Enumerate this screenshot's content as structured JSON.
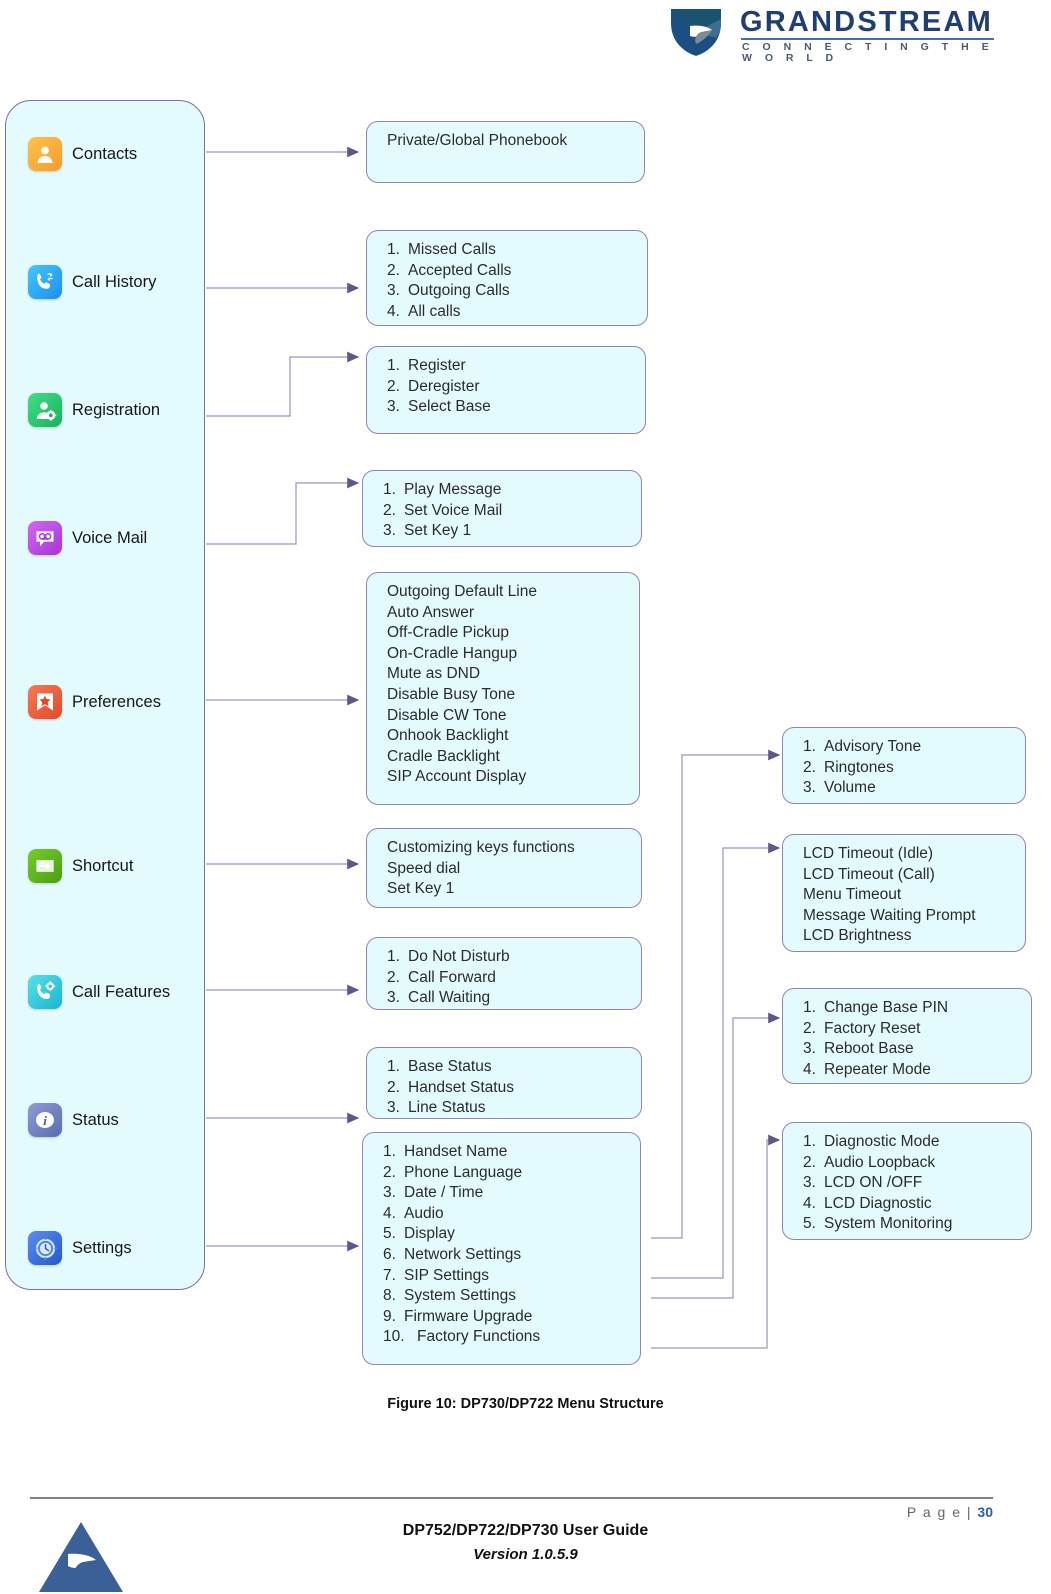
{
  "header": {
    "brand": "GRANDSTREAM",
    "tagline": "C O N N E C T I N G   T H E   W O R L D",
    "logo_icon": "grandstream-shield-logo"
  },
  "menu": {
    "items": [
      {
        "label": "Contacts",
        "icon": "contacts-icon"
      },
      {
        "label": "Call History",
        "icon": "call-history-icon"
      },
      {
        "label": "Registration",
        "icon": "registration-icon"
      },
      {
        "label": "Voice Mail",
        "icon": "voice-mail-icon"
      },
      {
        "label": "Preferences",
        "icon": "preferences-icon"
      },
      {
        "label": "Shortcut",
        "icon": "shortcut-icon"
      },
      {
        "label": "Call Features",
        "icon": "call-features-icon"
      },
      {
        "label": "Status",
        "icon": "status-info-icon"
      },
      {
        "label": "Settings",
        "icon": "settings-gear-icon"
      }
    ]
  },
  "boxes": {
    "contacts": {
      "numbered": false,
      "lines": [
        "Private/Global Phonebook"
      ]
    },
    "call_history": {
      "numbered": true,
      "lines": [
        "Missed Calls",
        "Accepted Calls",
        "Outgoing Calls",
        "All calls"
      ]
    },
    "registration": {
      "numbered": true,
      "lines": [
        "Register",
        "Deregister",
        "Select Base"
      ]
    },
    "voice_mail": {
      "numbered": true,
      "lines": [
        "Play Message",
        "Set Voice Mail",
        "Set Key 1"
      ]
    },
    "preferences": {
      "numbered": false,
      "lines": [
        "Outgoing Default Line",
        "Auto Answer",
        "Off-Cradle Pickup",
        "On-Cradle Hangup",
        "Mute as DND",
        "Disable Busy Tone",
        "Disable CW Tone",
        "Onhook Backlight",
        "Cradle Backlight",
        "SIP Account Display"
      ]
    },
    "shortcut": {
      "numbered": false,
      "lines": [
        "Customizing keys functions",
        "Speed dial",
        "Set Key 1"
      ]
    },
    "call_features": {
      "numbered": true,
      "lines": [
        "Do Not Disturb",
        "Call Forward",
        "Call Waiting"
      ]
    },
    "status": {
      "numbered": true,
      "lines": [
        "Base Status",
        "Handset Status",
        "Line Status"
      ]
    },
    "settings": {
      "numbered": true,
      "lines": [
        "Handset Name",
        "Phone Language",
        "Date / Time",
        "Audio",
        "Display",
        "Network Settings",
        "SIP Settings",
        "System Settings",
        "Firmware Upgrade",
        "Factory Functions"
      ]
    },
    "audio": {
      "numbered": true,
      "lines": [
        "Advisory Tone",
        "Ringtones",
        "Volume"
      ]
    },
    "display": {
      "numbered": false,
      "lines": [
        "LCD Timeout (Idle)",
        "LCD Timeout (Call)",
        "Menu Timeout",
        "Message Waiting Prompt",
        "LCD Brightness"
      ]
    },
    "system": {
      "numbered": true,
      "lines": [
        "Change Base PIN",
        "Factory Reset",
        "Reboot Base",
        "Repeater Mode"
      ]
    },
    "factory": {
      "numbered": true,
      "lines": [
        "Diagnostic Mode",
        "Audio Loopback",
        "LCD ON /OFF",
        "LCD Diagnostic",
        "System Monitoring"
      ]
    }
  },
  "caption": "Figure 10: DP730/DP722 Menu Structure",
  "footer": {
    "page_label": "P a g e  |",
    "page_number": "30",
    "title": "DP752/DP722/DP730 User Guide",
    "version": "Version 1.0.5.9",
    "logo_icon": "grandstream-triangle-logo"
  },
  "colors": {
    "box_fill": "#e3fbfc",
    "box_border": "#8f86b5",
    "wire": "#7b74a8",
    "brand_blue": "#1f3f73"
  }
}
